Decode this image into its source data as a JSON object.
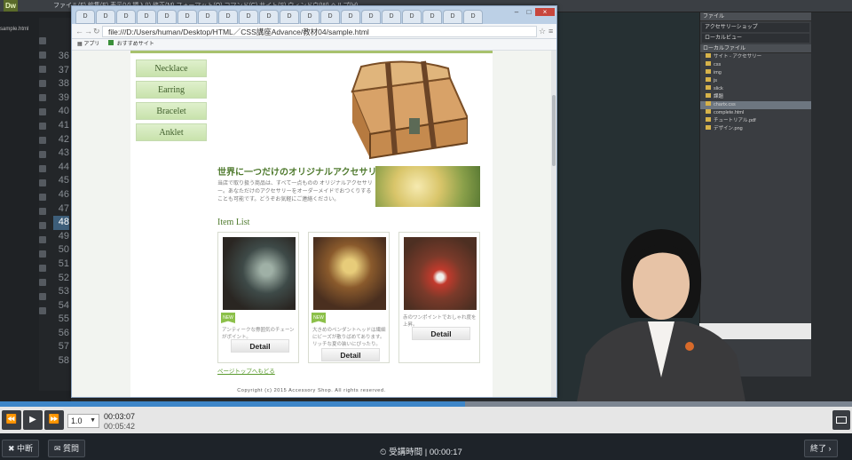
{
  "dreamweaver": {
    "logo": "Dw",
    "file_tab": "sample.html",
    "line_numbers": [
      "36",
      "37",
      "38",
      "39",
      "40",
      "41",
      "42",
      "43",
      "44",
      "45",
      "46",
      "47",
      "48",
      "49",
      "50",
      "51",
      "52",
      "53",
      "54",
      "55",
      "56",
      "57",
      "58"
    ],
    "current_line": "48",
    "files_panel": {
      "header": "ファイル",
      "dropdowns": [
        "アクセサリーショップ",
        "ローカルビュー"
      ],
      "columns": "ローカルファイル",
      "rows": [
        "サイト - アクセサリー",
        "css",
        "img",
        "js",
        "slick",
        "課題",
        "chartx.css",
        "complete.html",
        "チュートリアル.pdf",
        "デザイン.png"
      ]
    }
  },
  "browser": {
    "url": "file:///D:/Users/human/Desktop/HTML／CSS講座Advance/教材04/sample.html",
    "bookmarks": {
      "apps": "アプリ",
      "suggested": "おすすめサイト"
    },
    "close": "×"
  },
  "site": {
    "nav": [
      "Necklace",
      "Earring",
      "Bracelet",
      "Anklet"
    ],
    "catch_title": "世界に一つだけのオリジナルアクセサリー",
    "catch_text": "当店で取り扱う商品は、すべて一点ものの オリジナルアクセサリー。あなただけのアクセサリーをオーダーメイドでおつくりすることも可能です。どうぞお気軽にご連絡ください。",
    "item_list_title": "Item List",
    "items": [
      {
        "badge": "NEW",
        "desc": "アンティークな雰囲気のチェーンがポイント。",
        "button": "Detail"
      },
      {
        "badge": "NEW",
        "desc": "大きめのペンダントヘッドは繊細にビーズが散りばめてあります。リッチな夏の装いにぴったり。",
        "button": "Detail"
      },
      {
        "badge": "",
        "desc": "赤のワンポイントでおしゃれ度を上昇。",
        "button": "Detail"
      }
    ],
    "pagetop": "ページトップへもどる",
    "copyright": "Copyright (c) 2015 Accessory Shop. All rights reserved."
  },
  "player": {
    "speed": "1.0",
    "current_time": "00:03:07",
    "total_time": "00:05:42",
    "progress": 0.546,
    "suspend": "中断",
    "question": "質問",
    "elapsed_label": "受講時間",
    "elapsed_time": "00:00:17",
    "end": "終了"
  }
}
